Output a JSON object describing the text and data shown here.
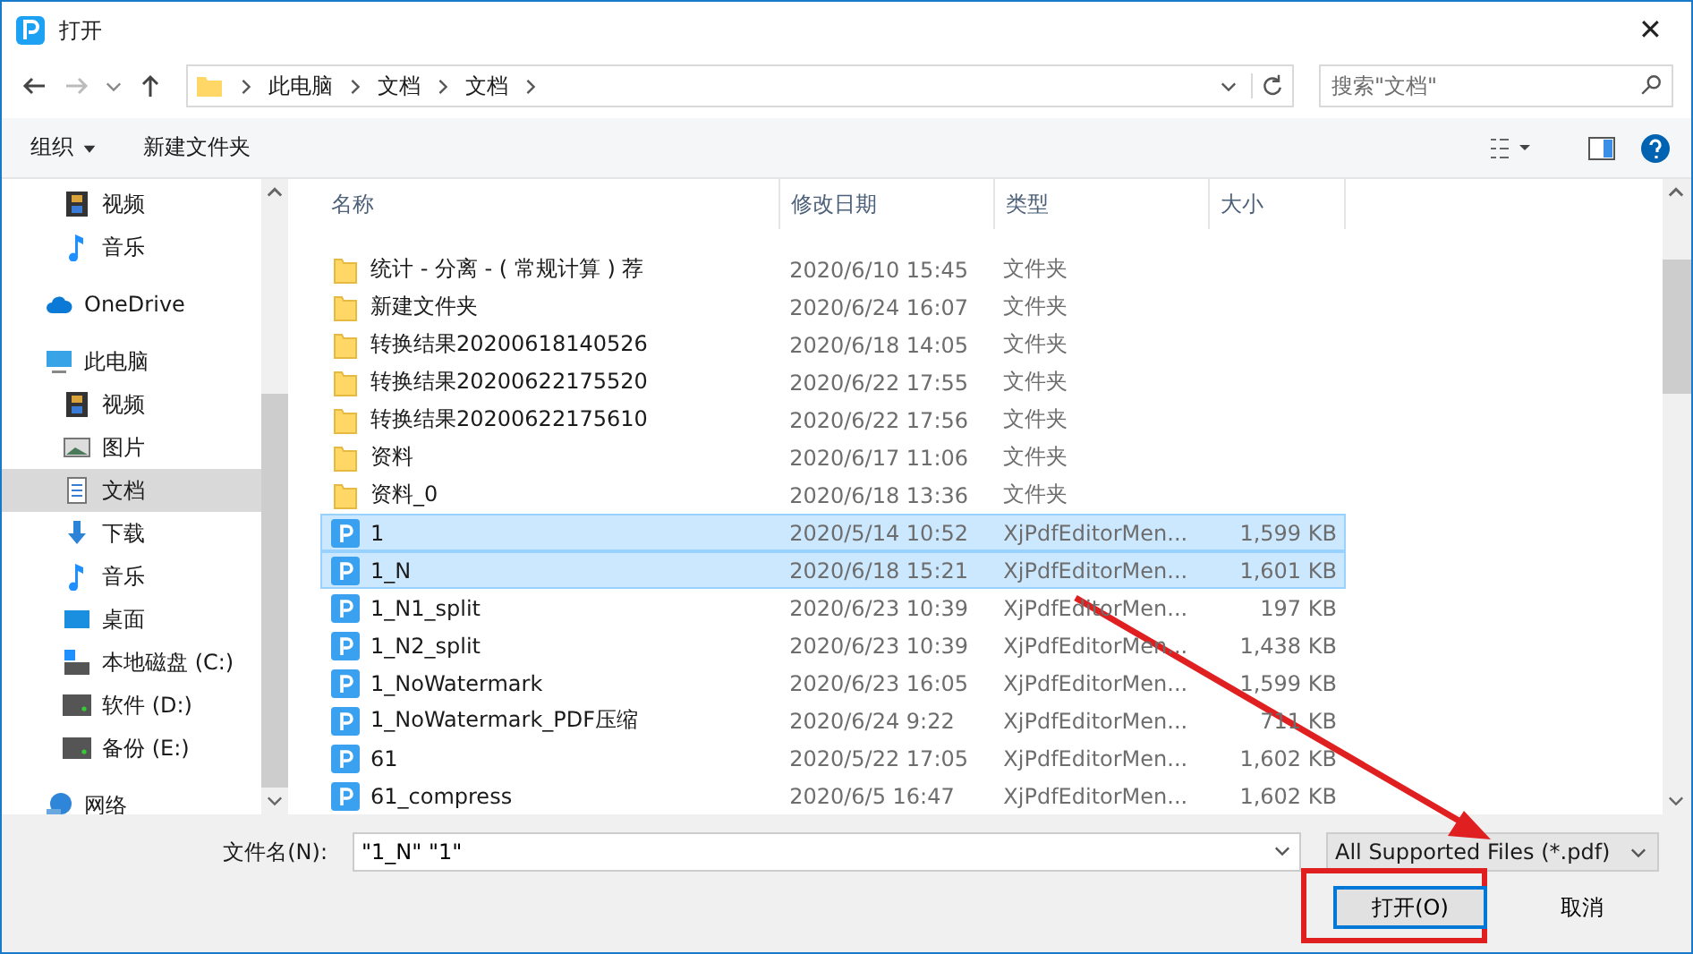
{
  "window": {
    "title": "打开",
    "close_glyph": "✕"
  },
  "nav": {
    "breadcrumb": [
      "此电脑",
      "文档",
      "文档"
    ],
    "search": {
      "placeholder": "搜索\"文档\""
    }
  },
  "toolbar": {
    "organize": "组织",
    "new_folder": "新建文件夹"
  },
  "sidebar": {
    "continued_items": [
      {
        "label": "视频",
        "kind": "video",
        "selected": false
      },
      {
        "label": "音乐",
        "kind": "music",
        "selected": false
      }
    ],
    "items": [
      {
        "label": "OneDrive",
        "kind": "cloud",
        "selected": false
      },
      {
        "label": "此电脑",
        "kind": "pc",
        "selected": false,
        "children": [
          {
            "label": "视频",
            "kind": "video",
            "selected": false
          },
          {
            "label": "图片",
            "kind": "picture",
            "selected": false
          },
          {
            "label": "文档",
            "kind": "doc",
            "selected": true
          },
          {
            "label": "下载",
            "kind": "download",
            "selected": false
          },
          {
            "label": "音乐",
            "kind": "music",
            "selected": false
          },
          {
            "label": "桌面",
            "kind": "desktop",
            "selected": false
          },
          {
            "label": "本地磁盘 (C:)",
            "kind": "sysdrive",
            "selected": false
          },
          {
            "label": "软件 (D:)",
            "kind": "drive",
            "selected": false
          },
          {
            "label": "备份 (E:)",
            "kind": "drive",
            "selected": false
          }
        ]
      },
      {
        "label": "网络",
        "kind": "network",
        "selected": false
      }
    ]
  },
  "table": {
    "columns": [
      "名称",
      "修改日期",
      "类型",
      "大小"
    ],
    "rows": [
      {
        "kind": "folder",
        "name": "统计 - 分离 - ( 常规计算 ) 荐",
        "date": "2020/6/10 15:45",
        "type": "文件夹",
        "selected": false
      },
      {
        "kind": "folder",
        "name": "新建文件夹",
        "date": "2020/6/24 16:07",
        "type": "文件夹",
        "selected": false
      },
      {
        "kind": "folder",
        "name": "转换结果20200618140526",
        "date": "2020/6/18 14:05",
        "type": "文件夹",
        "selected": false
      },
      {
        "kind": "folder",
        "name": "转换结果20200622175520",
        "date": "2020/6/22 17:55",
        "type": "文件夹",
        "selected": false
      },
      {
        "kind": "folder",
        "name": "转换结果20200622175610",
        "date": "2020/6/22 17:56",
        "type": "文件夹",
        "selected": false
      },
      {
        "kind": "folder",
        "name": "资料",
        "date": "2020/6/17 11:06",
        "type": "文件夹",
        "selected": false
      },
      {
        "kind": "folder",
        "name": "资料_0",
        "date": "2020/6/18 13:36",
        "type": "文件夹",
        "selected": false
      },
      {
        "kind": "pdf",
        "name": "1",
        "date": "2020/5/14 10:52",
        "type": "XjPdfEditorMen...",
        "size": "1,599 KB",
        "selected": true
      },
      {
        "kind": "pdf",
        "name": "1_N",
        "date": "2020/6/18 15:21",
        "type": "XjPdfEditorMen...",
        "size": "1,601 KB",
        "selected": true
      },
      {
        "kind": "pdf",
        "name": "1_N1_split",
        "date": "2020/6/23 10:39",
        "type": "XjPdfEditorMen...",
        "size": "197 KB",
        "selected": false
      },
      {
        "kind": "pdf",
        "name": "1_N2_split",
        "date": "2020/6/23 10:39",
        "type": "XjPdfEditorMen...",
        "size": "1,438 KB",
        "selected": false
      },
      {
        "kind": "pdf",
        "name": "1_NoWatermark",
        "date": "2020/6/23 16:05",
        "type": "XjPdfEditorMen...",
        "size": "1,599 KB",
        "selected": false
      },
      {
        "kind": "pdf",
        "name": "1_NoWatermark_PDF压缩",
        "date": "2020/6/24 9:22",
        "type": "XjPdfEditorMen...",
        "size": "711 KB",
        "selected": false
      },
      {
        "kind": "pdf",
        "name": "61",
        "date": "2020/5/22 17:05",
        "type": "XjPdfEditorMen...",
        "size": "1,602 KB",
        "selected": false
      },
      {
        "kind": "pdf",
        "name": "61_compress",
        "date": "2020/6/5 16:47",
        "type": "XjPdfEditorMen...",
        "size": "1,602 KB",
        "selected": false
      }
    ]
  },
  "footer": {
    "filename_label": "文件名(N):",
    "filename": "\"1_N\" \"1\"",
    "filter": "All Supported Files (*.pdf)",
    "open": "打开(O)",
    "cancel": "取消"
  }
}
